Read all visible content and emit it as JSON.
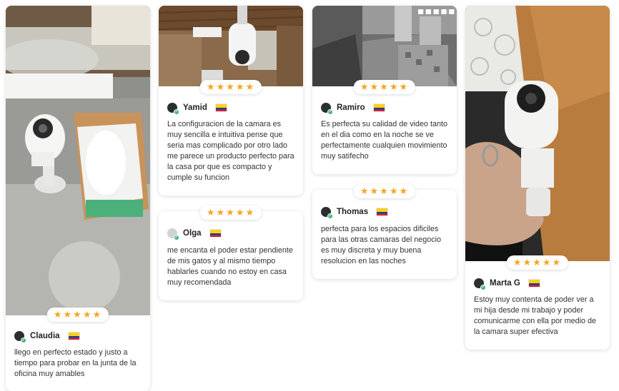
{
  "rating_stars": "★★★★★",
  "colors": {
    "star": "#f5a623",
    "verified": "#3cb371"
  },
  "reviews": [
    {
      "name": "Claudia",
      "country": "Colombia",
      "text": "llego en perfecto estado y justo a tiempo para probar en la junta de la oficina muy amables",
      "photo": "camera-in-box-photo"
    },
    {
      "name": "Yamid",
      "country": "Colombia",
      "text": "La configuracion de la camara es muy sencilla e intuitiva pense que seria mas complicado por otro lado me parece un producto perfecto para la casa por que es compacto y cumple su funcion",
      "photo": "ceiling-camera-photo"
    },
    {
      "name": "Olga",
      "country": "Colombia",
      "text": "me encanta el poder estar pendiente de mis gatos y al mismo tiempo hablarles cuando no estoy en casa muy recomendada",
      "photo": ""
    },
    {
      "name": "Ramiro",
      "country": "Colombia",
      "text": "Es perfecta su calidad de video tanto en el dia como en la noche se ve perfectamente cualquien movimiento muy satifecho",
      "photo": "night-vision-kitchen-photo"
    },
    {
      "name": "Thomas",
      "country": "Colombia",
      "text": "perfecta para los espacios dificiles para las otras camaras del negocio es muy discreta y muy buena resolucion en las noches",
      "photo": ""
    },
    {
      "name": "Marta G",
      "country": "Colombia",
      "text": "Estoy muy contenta de poder ver a mi hija desde mi trabajo y poder comunicarme con ella por medio de la camara super efectiva",
      "photo": "hand-holding-camera-photo"
    }
  ]
}
